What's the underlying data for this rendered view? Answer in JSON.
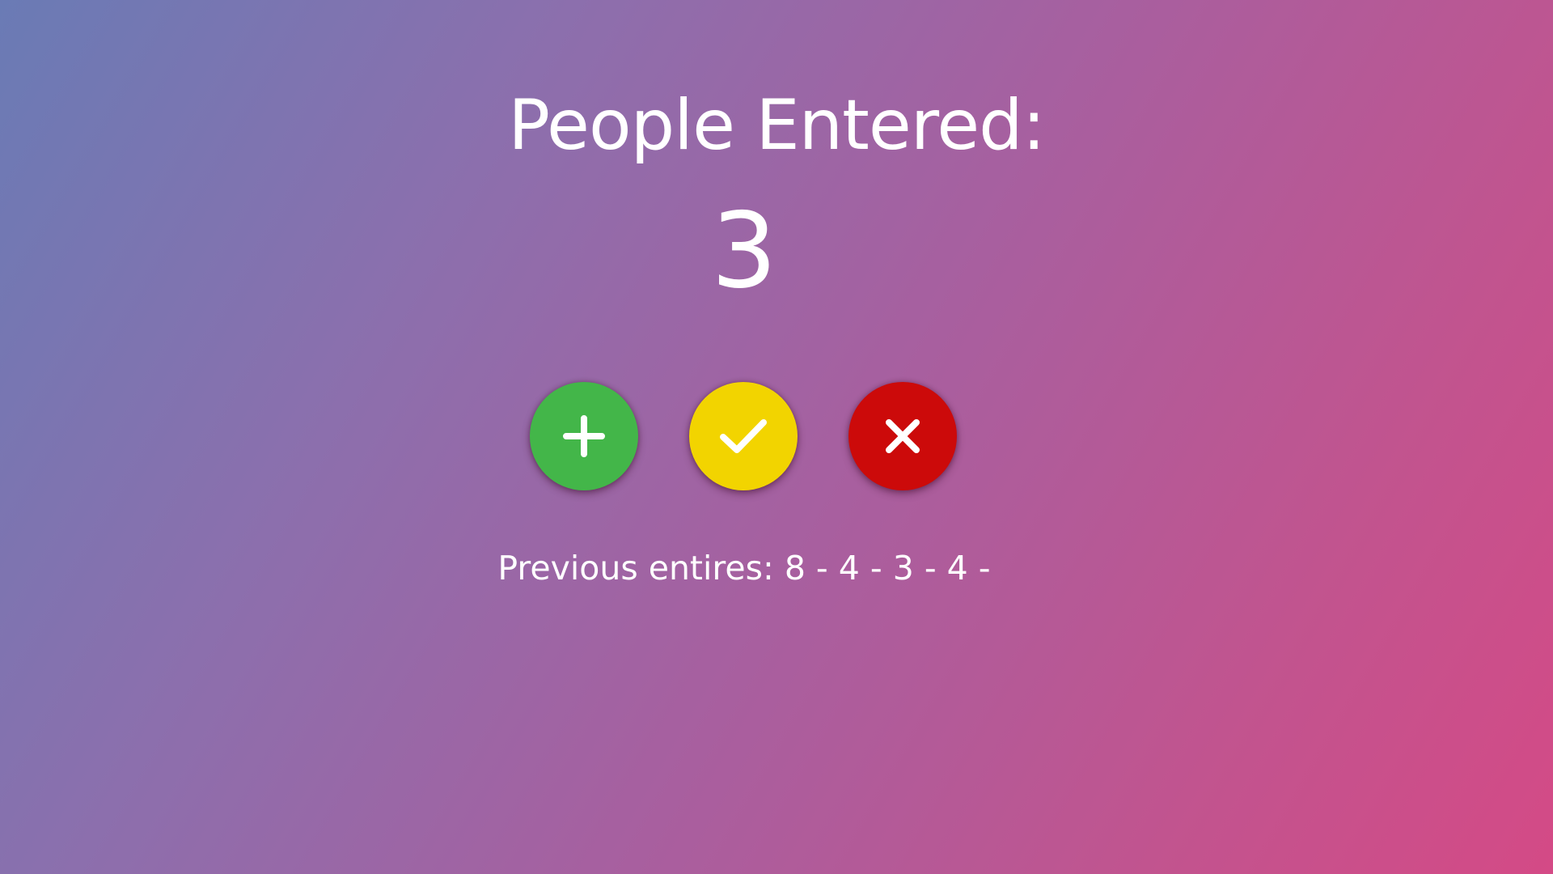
{
  "colors": {
    "add_button": "#43b649",
    "save_button": "#f2d400",
    "reset_button": "#cc0a0a",
    "text": "#ffffff",
    "gradient_start": "#6a7bb5",
    "gradient_end": "#d44a86"
  },
  "counter": {
    "title": "People Entered:",
    "value": "3"
  },
  "buttons": {
    "add": {
      "icon": "plus-icon"
    },
    "save": {
      "icon": "check-icon"
    },
    "reset": {
      "icon": "close-icon"
    }
  },
  "previous": {
    "label": "Previous entires:",
    "entries_text": "8 - 4 - 3 - 4 -"
  }
}
